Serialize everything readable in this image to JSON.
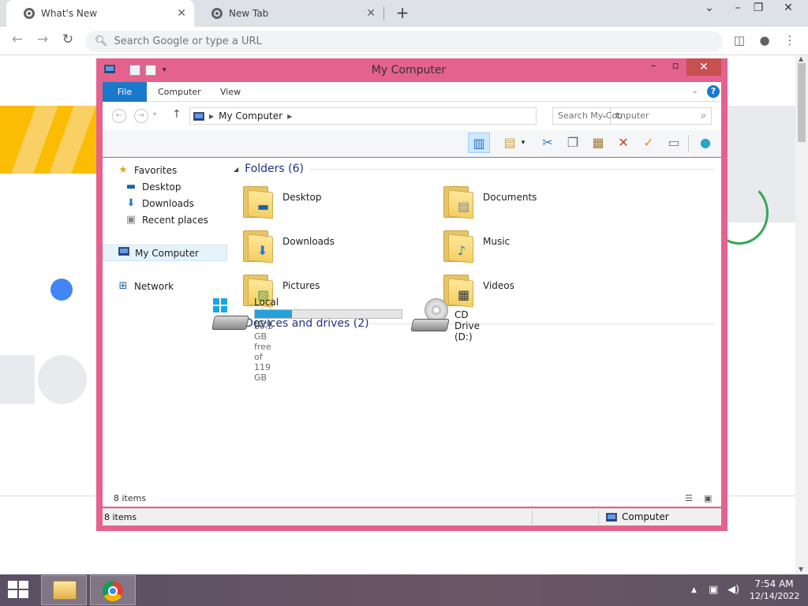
{
  "browser": {
    "tabs": [
      {
        "title": "What's New",
        "close": "✕"
      },
      {
        "title": "New Tab",
        "close": "✕"
      }
    ],
    "new_tab": "+",
    "omnibox_placeholder": "Search Google or type a URL"
  },
  "explorer": {
    "title": "My Computer",
    "ribbon": {
      "file": "File",
      "tabs": [
        "Computer",
        "View"
      ],
      "help": "?"
    },
    "address": {
      "location": "My Computer"
    },
    "search_placeholder": "Search My Computer",
    "nav": {
      "favorites": "Favorites",
      "favorite_items": [
        "Desktop",
        "Downloads",
        "Recent places"
      ],
      "my_computer": "My Computer",
      "network": "Network"
    },
    "folders_header": "Folders (6)",
    "folders": [
      "Desktop",
      "Documents",
      "Downloads",
      "Music",
      "Pictures",
      "Videos"
    ],
    "devices_header": "Devices and drives (2)",
    "drives": [
      {
        "name": "Local Disk (C:)",
        "free_text": "89.5 GB free of 119 GB",
        "used_fraction": 0.25
      },
      {
        "name": "CD Drive (D:)"
      }
    ],
    "footer_count": "8 items",
    "status": {
      "count": "8 items",
      "location": "Computer"
    }
  },
  "taskbar": {
    "time": "7:54 AM",
    "date": "12/14/2022"
  },
  "colors": {
    "window_frame": "#e4628d",
    "accent": "#1979ca",
    "drive_fill": "#26a0da"
  }
}
